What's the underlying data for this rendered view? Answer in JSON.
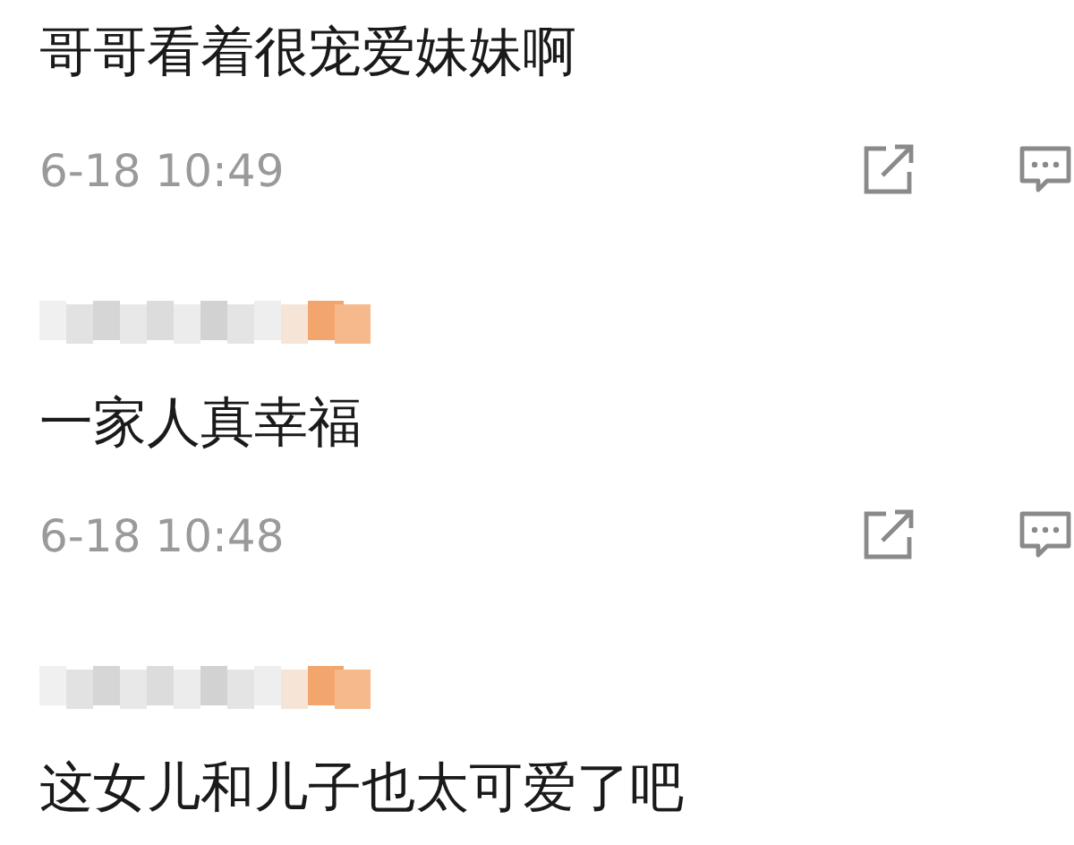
{
  "comments": [
    {
      "blurred_name": false,
      "text": "哥哥看着很宠爱妹妹啊",
      "time": "6-18 10:49"
    },
    {
      "blurred_name": true,
      "text": "一家人真幸福",
      "time": "6-18 10:48"
    },
    {
      "blurred_name": true,
      "text": "这女儿和儿子也太可爱了吧"
    }
  ]
}
